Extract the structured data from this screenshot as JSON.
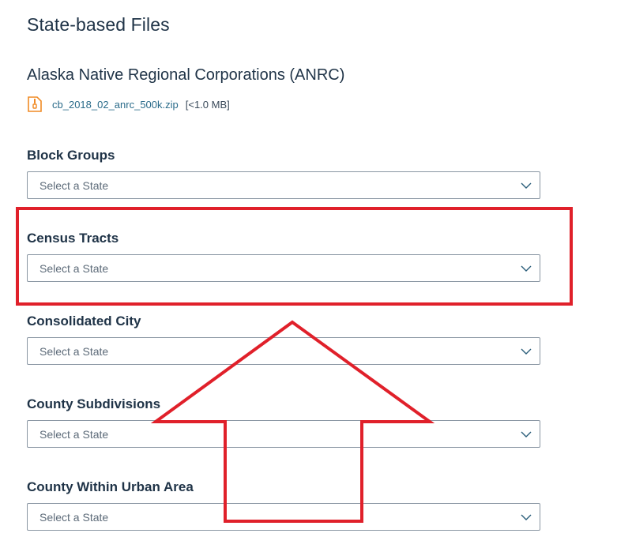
{
  "page": {
    "section_title": "State-based Files",
    "anrc": {
      "title": "Alaska Native Regional Corporations (ANRC)",
      "file_name": "cb_2018_02_anrc_500k.zip",
      "file_size": "[<1.0 MB]"
    },
    "fields": [
      {
        "label": "Block Groups",
        "placeholder": "Select a State"
      },
      {
        "label": "Census Tracts",
        "placeholder": "Select a State"
      },
      {
        "label": "Consolidated City",
        "placeholder": "Select a State"
      },
      {
        "label": "County Subdivisions",
        "placeholder": "Select a State"
      },
      {
        "label": "County Within Urban Area",
        "placeholder": "Select a State"
      }
    ]
  },
  "colors": {
    "annotation_red": "#e0202a",
    "link": "#2a6b8a",
    "zip_icon": "#f08a24"
  },
  "icons": {
    "zip": "zip-file-icon",
    "chevron": "chevron-down-icon"
  }
}
